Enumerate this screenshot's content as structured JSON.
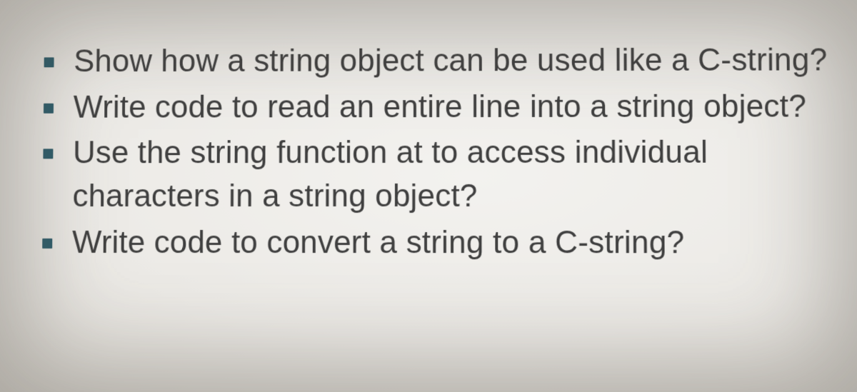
{
  "bullets": [
    "Show how a string object can be used like a C-string?",
    "Write code to read an entire line into a string object?",
    "Use the string function at to access individual characters in a string object?",
    "Write code to convert a string to a C-string?"
  ]
}
